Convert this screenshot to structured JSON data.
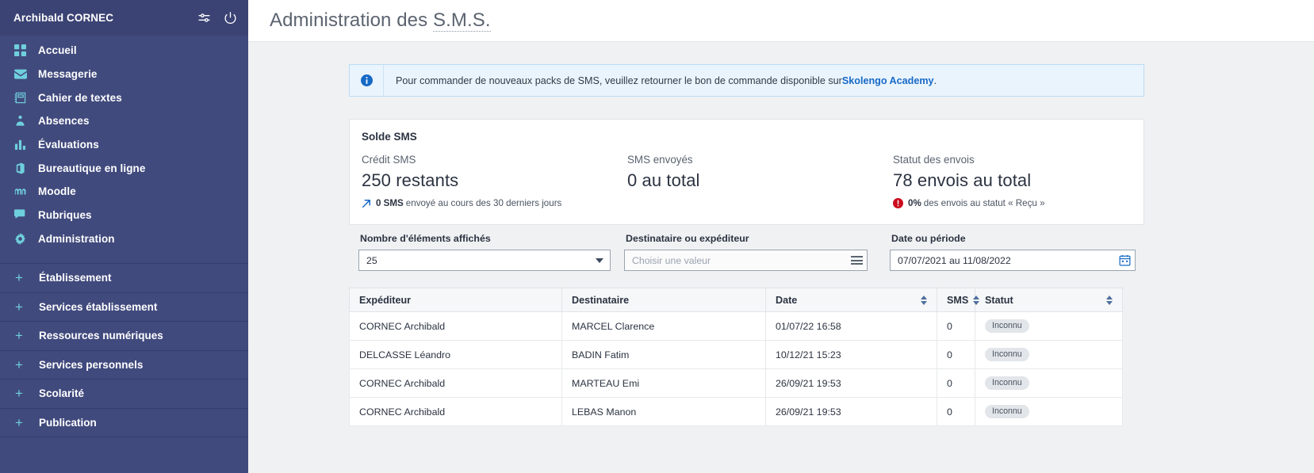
{
  "sidebar": {
    "user": "Archibald CORNEC",
    "top_icons": [
      {
        "name": "settings-sliders-icon",
        "label": "Paramètres"
      },
      {
        "name": "power-icon",
        "label": "Déconnexion"
      }
    ],
    "items": [
      {
        "label": "Accueil",
        "icon": "grid-icon"
      },
      {
        "label": "Messagerie",
        "icon": "envelope-icon"
      },
      {
        "label": "Cahier de textes",
        "icon": "notebook-icon"
      },
      {
        "label": "Absences",
        "icon": "people-icon"
      },
      {
        "label": "Évaluations",
        "icon": "bar-chart-icon"
      },
      {
        "label": "Bureautique en ligne",
        "icon": "office-icon"
      },
      {
        "label": "Moodle",
        "icon": "moodle-icon"
      },
      {
        "label": "Rubriques",
        "icon": "speech-bubble-icon"
      },
      {
        "label": "Administration",
        "icon": "gear-icon"
      }
    ],
    "sections": [
      {
        "label": "Établissement",
        "expander": "+"
      },
      {
        "label": "Services établissement",
        "expander": "+"
      },
      {
        "label": "Ressources numériques",
        "expander": "+"
      },
      {
        "label": "Services personnels",
        "expander": "+"
      },
      {
        "label": "Scolarité",
        "expander": "+"
      },
      {
        "label": "Publication",
        "expander": "+"
      }
    ]
  },
  "header": {
    "title_prefix": "Administration des ",
    "title_abbr": "S.M.S."
  },
  "banner": {
    "icon": "info-icon",
    "text_before": "Pour commander de nouveaux packs de SMS, veuillez retourner le bon de commande disponible sur ",
    "link": "Skolengo Academy",
    "text_after": "."
  },
  "card": {
    "title": "Solde SMS",
    "stats": [
      {
        "label": "Crédit SMS",
        "value": "250 restants",
        "note_icon": "arrow-up-right-icon",
        "note_strong": "0 SMS",
        "note_text": "envoyé au cours des 30 derniers jours"
      },
      {
        "label": "SMS envoyés",
        "value": "0 au total",
        "note_icon": "",
        "note_strong": "",
        "note_text": ""
      },
      {
        "label": "Statut des envois",
        "value": "78 envois au total",
        "note_icon": "alert-circle-icon",
        "note_strong": "0%",
        "note_text": "des envois au statut « Reçu »"
      }
    ]
  },
  "filters": {
    "count": {
      "label": "Nombre d'éléments affichés",
      "value": "25",
      "icon": "chevron-down-icon"
    },
    "recipient": {
      "label": "Destinataire ou expéditeur",
      "placeholder": "Choisir une valeur",
      "value": "",
      "icon": "list-menu-icon"
    },
    "date": {
      "label": "Date ou période",
      "value": "07/07/2021 au 11/08/2022",
      "icon": "calendar-icon"
    }
  },
  "table": {
    "columns": [
      {
        "label": "Expéditeur",
        "sortable": false
      },
      {
        "label": "Destinataire",
        "sortable": false
      },
      {
        "label": "Date",
        "sortable": true
      },
      {
        "label": "SMS",
        "sortable": true
      },
      {
        "label": "Statut",
        "sortable": true
      }
    ],
    "rows": [
      {
        "expediteur": "CORNEC Archibald",
        "destinataire": "MARCEL Clarence",
        "date": "01/07/22 16:58",
        "sms": "0",
        "statut": "Inconnu"
      },
      {
        "expediteur": "DELCASSE Léandro",
        "destinataire": "BADIN Fatim",
        "date": "10/12/21 15:23",
        "sms": "0",
        "statut": "Inconnu"
      },
      {
        "expediteur": "CORNEC Archibald",
        "destinataire": "MARTEAU Emi",
        "date": "26/09/21 19:53",
        "sms": "0",
        "statut": "Inconnu"
      },
      {
        "expediteur": "CORNEC Archibald",
        "destinataire": "LEBAS Manon",
        "date": "26/09/21 19:53",
        "sms": "0",
        "statut": "Inconnu"
      }
    ]
  },
  "colors": {
    "sidebar_bg": "#414a7d",
    "accent_cyan": "#6fd0dd",
    "link_blue": "#1769c6",
    "alert_red": "#cc0b1e",
    "banner_bg": "#eaf4fd"
  }
}
